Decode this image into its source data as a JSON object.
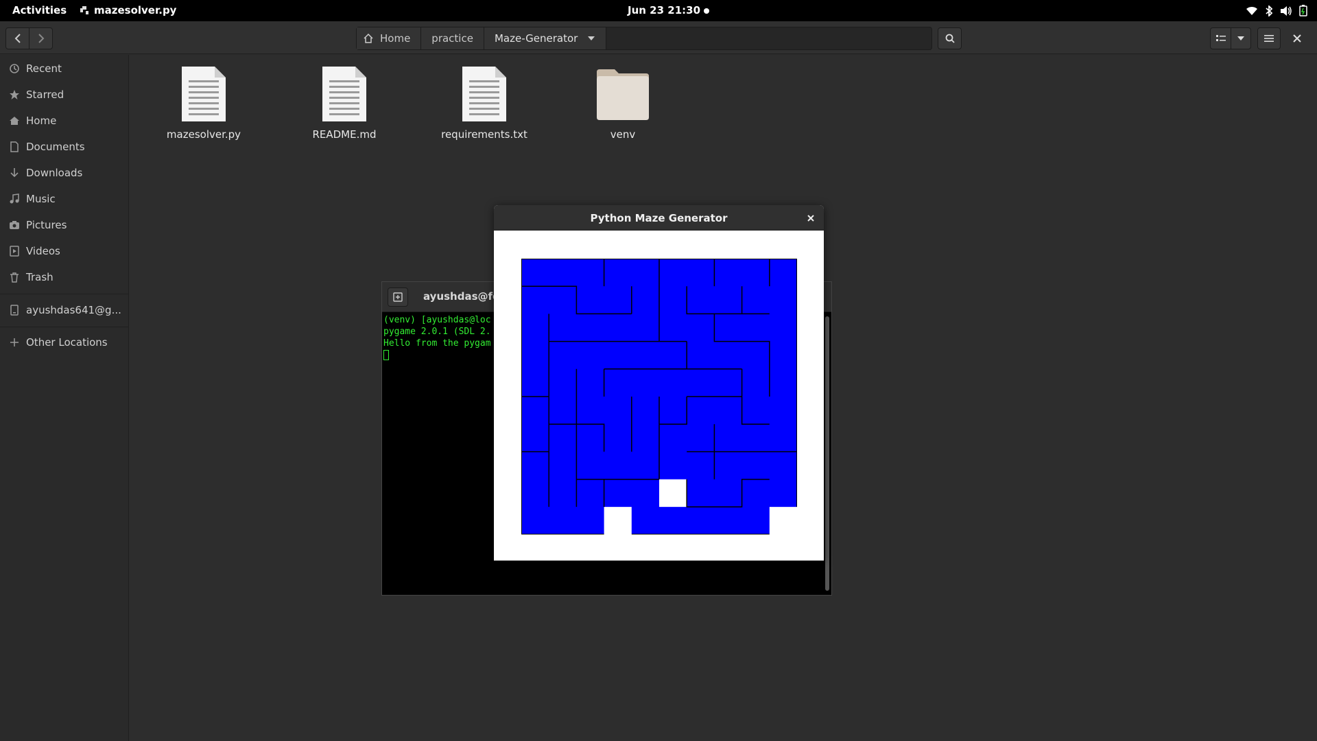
{
  "topbar": {
    "activities": "Activities",
    "app_name": "mazesolver.py",
    "datetime": "Jun 23  21:30",
    "tray_icons": [
      "wifi-icon",
      "bluetooth-icon",
      "volume-icon",
      "battery-icon"
    ]
  },
  "pathbar": {
    "crumbs": [
      "Home",
      "practice",
      "Maze-Generator"
    ]
  },
  "sidebar": {
    "items": [
      {
        "label": "Recent",
        "icon": "clock-icon"
      },
      {
        "label": "Starred",
        "icon": "star-icon"
      },
      {
        "label": "Home",
        "icon": "home-icon"
      },
      {
        "label": "Documents",
        "icon": "document-icon"
      },
      {
        "label": "Downloads",
        "icon": "download-icon"
      },
      {
        "label": "Music",
        "icon": "music-icon"
      },
      {
        "label": "Pictures",
        "icon": "camera-icon"
      },
      {
        "label": "Videos",
        "icon": "video-icon"
      },
      {
        "label": "Trash",
        "icon": "trash-icon"
      }
    ],
    "drive": {
      "label": "ayushdas641@g...",
      "icon": "drive-icon"
    },
    "other": {
      "label": "Other Locations",
      "icon": "plus-icon"
    }
  },
  "files": [
    {
      "name": "mazesolver.py",
      "type": "file"
    },
    {
      "name": "README.md",
      "type": "file"
    },
    {
      "name": "requirements.txt",
      "type": "file"
    },
    {
      "name": "venv",
      "type": "folder"
    }
  ],
  "terminal": {
    "title": "ayushdas@fed",
    "lines": [
      "(venv) [ayushdas@loc",
      "pygame 2.0.1 (SDL 2.",
      "Hello from the pygam"
    ]
  },
  "pygame_window": {
    "title": "Python Maze Generator"
  },
  "colors": {
    "maze_fill": "#0000ff",
    "maze_wall": "#000000",
    "maze_open_cell": "#ffffff",
    "terminal_text": "#33ee33"
  }
}
